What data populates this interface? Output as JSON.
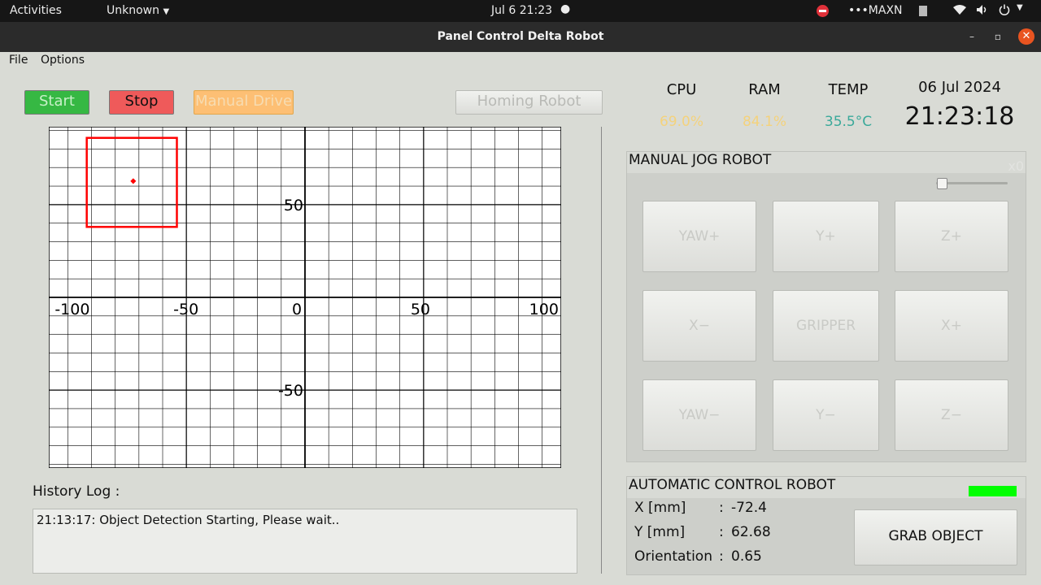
{
  "system_bar": {
    "activities": "Activities",
    "app_menu": "Unknown",
    "clock": "Jul 6  21:23",
    "power_mode": "MAXN"
  },
  "window": {
    "title": "Panel Control Delta Robot"
  },
  "menu": {
    "file": "File",
    "options": "Options"
  },
  "toolbar": {
    "start": "Start",
    "stop": "Stop",
    "manual_drive": "Manual Drive",
    "homing": "Homing Robot"
  },
  "chart_data": {
    "type": "scatter",
    "x_ticks": [
      "-100",
      "-50",
      "0",
      "50",
      "100"
    ],
    "y_ticks": [
      "50",
      "-50"
    ],
    "xlim": [
      -108,
      108
    ],
    "ylim": [
      -92,
      92
    ],
    "grid": true,
    "bounding_box": {
      "x0": -92,
      "x1": -54,
      "y0": 38,
      "y1": 86
    },
    "point": {
      "x": -72.4,
      "y": 62.68
    },
    "colors": {
      "box": "#ff0000",
      "point": "#ff0000"
    }
  },
  "system_stats": {
    "cpu_label": "CPU",
    "cpu_value": "69.0%",
    "ram_label": "RAM",
    "ram_value": "84.1%",
    "temp_label": "TEMP",
    "temp_value": "35.5°C",
    "date": "06 Jul 2024",
    "time": "21:23:18"
  },
  "manual_jog": {
    "title": "MANUAL JOG ROBOT",
    "speed": "x0",
    "buttons": [
      "YAW+",
      "Y+",
      "Z+",
      "X−",
      "GRIPPER",
      "X+",
      "YAW−",
      "Y−",
      "Z−"
    ]
  },
  "automatic": {
    "title": "AUTOMATIC CONTROL ROBOT",
    "status_color": "#00ff00",
    "x_label": "X [mm]",
    "x_value": "-72.4",
    "y_label": "Y [mm]",
    "y_value": "62.68",
    "orient_label": "Orientation",
    "orient_value": "0.65",
    "colon": ":",
    "grab": "GRAB OBJECT"
  },
  "history": {
    "title": "History Log :",
    "entries": [
      "21:13:17: Object Detection Starting, Please wait.."
    ]
  }
}
